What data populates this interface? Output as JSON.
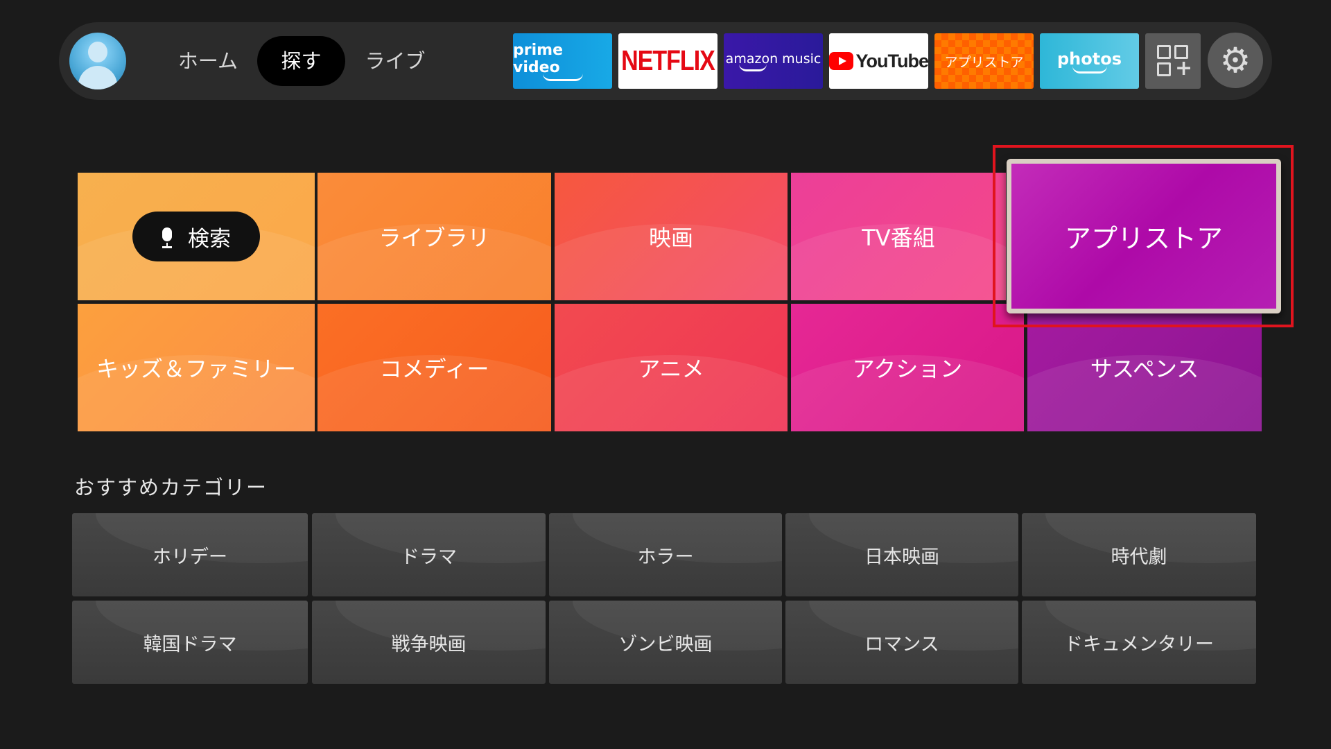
{
  "nav": {
    "home": "ホーム",
    "search": "探す",
    "live": "ライブ"
  },
  "apps": {
    "prime": "prime video",
    "netflix": "NETFLIX",
    "music": "amazon music",
    "youtube": "YouTube",
    "appstore": "アプリストア",
    "photos": "photos"
  },
  "categories": {
    "search": "検索",
    "library": "ライブラリ",
    "movies": "映画",
    "tv": "TV番組",
    "appstore": "アプリストア",
    "kids": "キッズ＆ファミリー",
    "comedy": "コメディー",
    "anime": "アニメ",
    "action": "アクション",
    "suspense": "サスペンス"
  },
  "recommended": {
    "title": "おすすめカテゴリー",
    "items": [
      "ホリデー",
      "ドラマ",
      "ホラー",
      "日本映画",
      "時代劇",
      "韓国ドラマ",
      "戦争映画",
      "ゾンビ映画",
      "ロマンス",
      "ドキュメンタリー"
    ]
  }
}
